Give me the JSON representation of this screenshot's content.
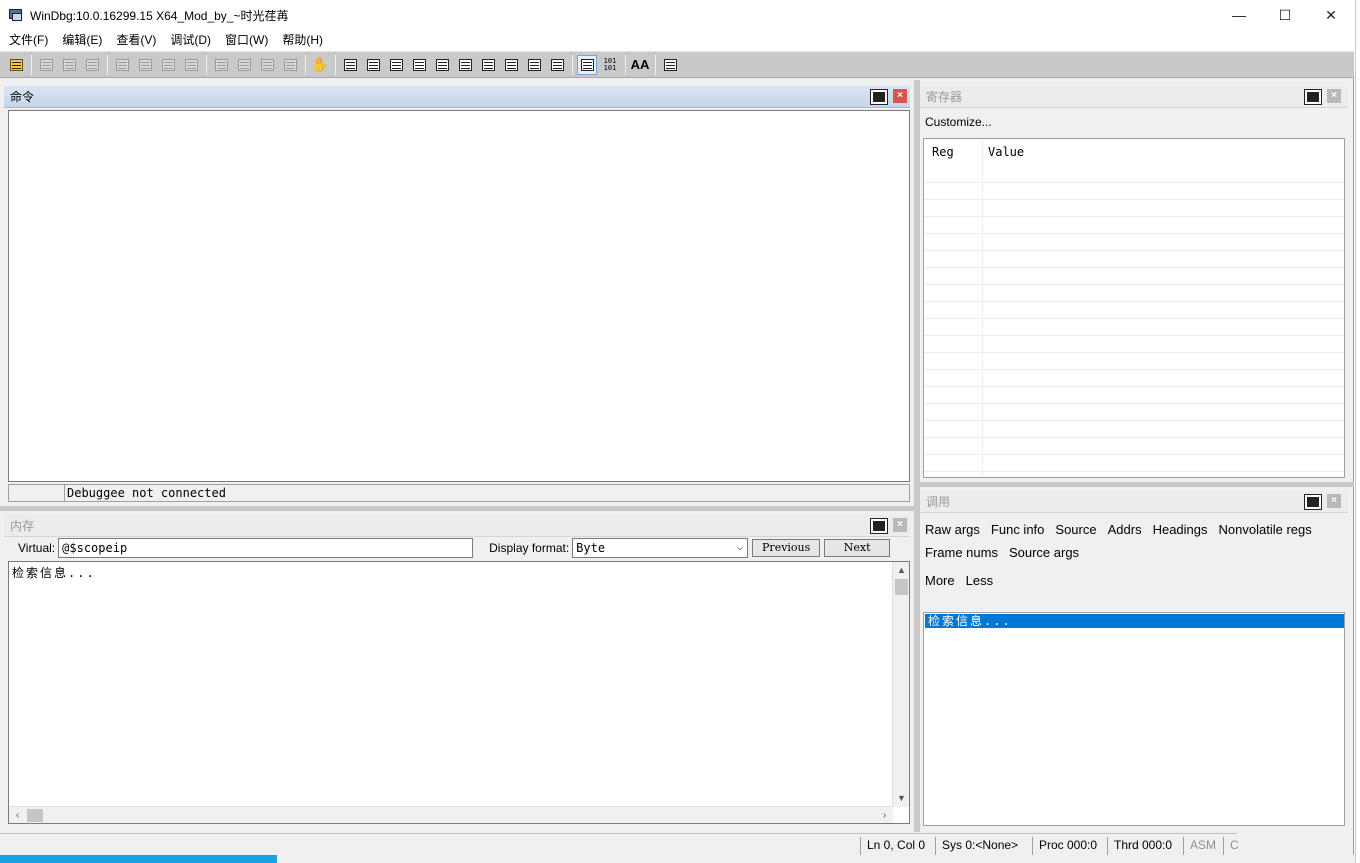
{
  "window": {
    "title": "WinDbg:10.0.16299.15 X64_Mod_by_~时光荏苒",
    "controls": {
      "minimize": "—",
      "maximize": "☐",
      "close": "✕"
    }
  },
  "menu": [
    "文件(F)",
    "编辑(E)",
    "查看(V)",
    "调试(D)",
    "窗口(W)",
    "帮助(H)"
  ],
  "toolbar": {
    "buttons": [
      "open-icon",
      "cut-icon",
      "copy-icon",
      "paste-icon",
      "go-icon",
      "restart-icon",
      "stop-debugging-icon",
      "detach-icon",
      "step-into-icon",
      "step-over-icon",
      "step-out-icon",
      "run-to-cursor-icon",
      "break-icon",
      "command-window-icon",
      "watch-window-icon",
      "locals-window-icon",
      "registers-window-icon",
      "memory-window-icon",
      "call-stack-icon",
      "disassembly-icon",
      "scratch-pad-icon",
      "processes-threads-icon",
      "source-mode-icon",
      "hex-mode-icon",
      "font-icon",
      "options-icon"
    ],
    "hex_label": "101\n101",
    "font_label": "AA"
  },
  "command_pane": {
    "title": "命令",
    "status": "Debuggee not connected"
  },
  "registers_pane": {
    "title": "寄存器",
    "customize": "Customize...",
    "columns": [
      "Reg",
      "Value"
    ]
  },
  "memory_pane": {
    "title": "内存",
    "virtual_label": "Virtual:",
    "virtual_value": "@$scopeip",
    "display_format_label": "Display format:",
    "display_format_value": "Byte",
    "previous": "Previous",
    "next": "Next",
    "content": "检索信息..."
  },
  "calls_pane": {
    "title": "调用",
    "options_row1": [
      "Raw args",
      "Func info",
      "Source",
      "Addrs",
      "Headings",
      "Nonvolatile regs"
    ],
    "options_row2": [
      "Frame nums",
      "Source args"
    ],
    "more": "More",
    "less": "Less",
    "content": "检索信息..."
  },
  "status_bar": {
    "position": "Ln 0, Col 0",
    "sys": "Sys 0:<None>",
    "proc": "Proc 000:0",
    "thrd": "Thrd 000:0",
    "asm": "ASM",
    "extra": "C"
  },
  "colors": {
    "active_title": "#c7d5ea",
    "selection": "#0078d7",
    "toolbar": "#c9c9c9"
  }
}
